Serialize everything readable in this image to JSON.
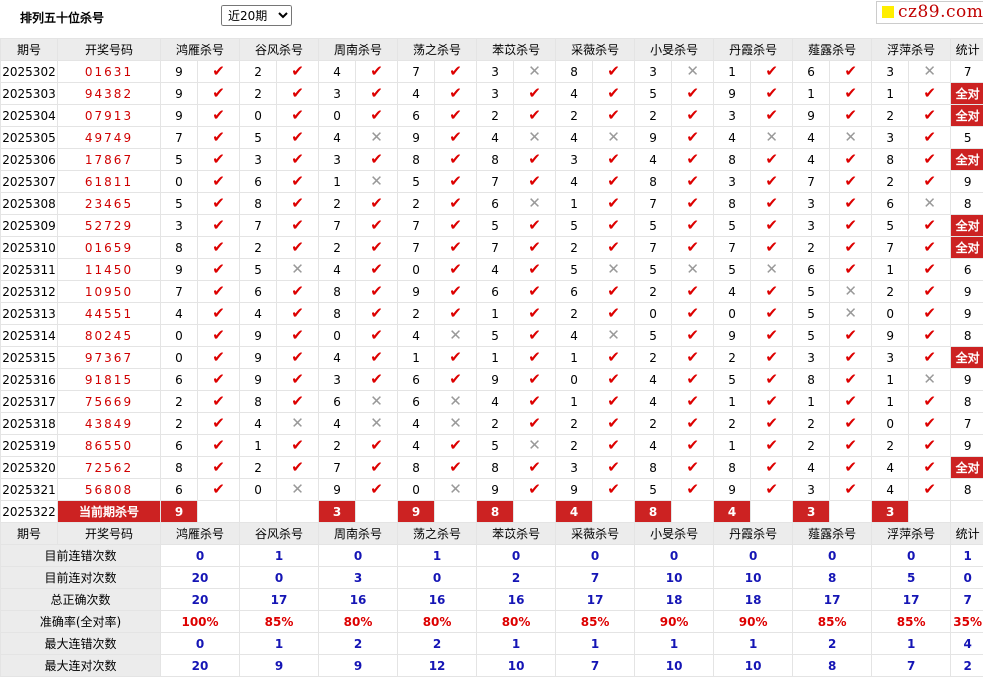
{
  "header": {
    "title": "排列五十位杀号",
    "period_select": "近20期",
    "logo_text": "cz89.com"
  },
  "columns": {
    "issue": "期号",
    "draw": "开奖号码",
    "stat": "统计",
    "killers": [
      "鸿雁杀号",
      "谷风杀号",
      "周南杀号",
      "荡之杀号",
      "苯苡杀号",
      "采薇杀号",
      "小旻杀号",
      "丹霞杀号",
      "薤露杀号",
      "浮萍杀号"
    ]
  },
  "rows": [
    {
      "issue": "2025302",
      "draw": "01631",
      "kills": [
        [
          9,
          1
        ],
        [
          2,
          1
        ],
        [
          4,
          1
        ],
        [
          7,
          1
        ],
        [
          3,
          0
        ],
        [
          8,
          1
        ],
        [
          3,
          0
        ],
        [
          1,
          1
        ],
        [
          6,
          1
        ],
        [
          3,
          0
        ]
      ],
      "stat": "7"
    },
    {
      "issue": "2025303",
      "draw": "94382",
      "kills": [
        [
          9,
          1
        ],
        [
          2,
          1
        ],
        [
          3,
          1
        ],
        [
          4,
          1
        ],
        [
          3,
          1
        ],
        [
          4,
          1
        ],
        [
          5,
          1
        ],
        [
          9,
          1
        ],
        [
          1,
          1
        ],
        [
          1,
          1
        ]
      ],
      "stat": "全对"
    },
    {
      "issue": "2025304",
      "draw": "07913",
      "kills": [
        [
          9,
          1
        ],
        [
          0,
          1
        ],
        [
          0,
          1
        ],
        [
          6,
          1
        ],
        [
          2,
          1
        ],
        [
          2,
          1
        ],
        [
          2,
          1
        ],
        [
          3,
          1
        ],
        [
          9,
          1
        ],
        [
          2,
          1
        ]
      ],
      "stat": "全对"
    },
    {
      "issue": "2025305",
      "draw": "49749",
      "kills": [
        [
          7,
          1
        ],
        [
          5,
          1
        ],
        [
          4,
          0
        ],
        [
          9,
          1
        ],
        [
          4,
          0
        ],
        [
          4,
          0
        ],
        [
          9,
          1
        ],
        [
          4,
          0
        ],
        [
          4,
          0
        ],
        [
          3,
          1
        ]
      ],
      "stat": "5"
    },
    {
      "issue": "2025306",
      "draw": "17867",
      "kills": [
        [
          5,
          1
        ],
        [
          3,
          1
        ],
        [
          3,
          1
        ],
        [
          8,
          1
        ],
        [
          8,
          1
        ],
        [
          3,
          1
        ],
        [
          4,
          1
        ],
        [
          8,
          1
        ],
        [
          4,
          1
        ],
        [
          8,
          1
        ]
      ],
      "stat": "全对"
    },
    {
      "issue": "2025307",
      "draw": "61811",
      "kills": [
        [
          0,
          1
        ],
        [
          6,
          1
        ],
        [
          1,
          0
        ],
        [
          5,
          1
        ],
        [
          7,
          1
        ],
        [
          4,
          1
        ],
        [
          8,
          1
        ],
        [
          3,
          1
        ],
        [
          7,
          1
        ],
        [
          2,
          1
        ]
      ],
      "stat": "9"
    },
    {
      "issue": "2025308",
      "draw": "23465",
      "kills": [
        [
          5,
          1
        ],
        [
          8,
          1
        ],
        [
          2,
          1
        ],
        [
          2,
          1
        ],
        [
          6,
          0
        ],
        [
          1,
          1
        ],
        [
          7,
          1
        ],
        [
          8,
          1
        ],
        [
          3,
          1
        ],
        [
          6,
          0
        ]
      ],
      "stat": "8"
    },
    {
      "issue": "2025309",
      "draw": "52729",
      "kills": [
        [
          3,
          1
        ],
        [
          7,
          1
        ],
        [
          7,
          1
        ],
        [
          7,
          1
        ],
        [
          5,
          1
        ],
        [
          5,
          1
        ],
        [
          5,
          1
        ],
        [
          5,
          1
        ],
        [
          3,
          1
        ],
        [
          5,
          1
        ]
      ],
      "stat": "全对"
    },
    {
      "issue": "2025310",
      "draw": "01659",
      "kills": [
        [
          8,
          1
        ],
        [
          2,
          1
        ],
        [
          2,
          1
        ],
        [
          7,
          1
        ],
        [
          7,
          1
        ],
        [
          2,
          1
        ],
        [
          7,
          1
        ],
        [
          7,
          1
        ],
        [
          2,
          1
        ],
        [
          7,
          1
        ]
      ],
      "stat": "全对"
    },
    {
      "issue": "2025311",
      "draw": "11450",
      "kills": [
        [
          9,
          1
        ],
        [
          5,
          0
        ],
        [
          4,
          1
        ],
        [
          0,
          1
        ],
        [
          4,
          1
        ],
        [
          5,
          0
        ],
        [
          5,
          0
        ],
        [
          5,
          0
        ],
        [
          6,
          1
        ],
        [
          1,
          1
        ]
      ],
      "stat": "6"
    },
    {
      "issue": "2025312",
      "draw": "10950",
      "kills": [
        [
          7,
          1
        ],
        [
          6,
          1
        ],
        [
          8,
          1
        ],
        [
          9,
          1
        ],
        [
          6,
          1
        ],
        [
          6,
          1
        ],
        [
          2,
          1
        ],
        [
          4,
          1
        ],
        [
          5,
          0
        ],
        [
          2,
          1
        ]
      ],
      "stat": "9"
    },
    {
      "issue": "2025313",
      "draw": "44551",
      "kills": [
        [
          4,
          1
        ],
        [
          4,
          1
        ],
        [
          8,
          1
        ],
        [
          2,
          1
        ],
        [
          1,
          1
        ],
        [
          2,
          1
        ],
        [
          0,
          1
        ],
        [
          0,
          1
        ],
        [
          5,
          0
        ],
        [
          0,
          1
        ]
      ],
      "stat": "9"
    },
    {
      "issue": "2025314",
      "draw": "80245",
      "kills": [
        [
          0,
          1
        ],
        [
          9,
          1
        ],
        [
          0,
          1
        ],
        [
          4,
          0
        ],
        [
          5,
          1
        ],
        [
          4,
          0
        ],
        [
          5,
          1
        ],
        [
          9,
          1
        ],
        [
          5,
          1
        ],
        [
          9,
          1
        ]
      ],
      "stat": "8"
    },
    {
      "issue": "2025315",
      "draw": "97367",
      "kills": [
        [
          0,
          1
        ],
        [
          9,
          1
        ],
        [
          4,
          1
        ],
        [
          1,
          1
        ],
        [
          1,
          1
        ],
        [
          1,
          1
        ],
        [
          2,
          1
        ],
        [
          2,
          1
        ],
        [
          3,
          1
        ],
        [
          3,
          1
        ]
      ],
      "stat": "全对"
    },
    {
      "issue": "2025316",
      "draw": "91815",
      "kills": [
        [
          6,
          1
        ],
        [
          9,
          1
        ],
        [
          3,
          1
        ],
        [
          6,
          1
        ],
        [
          9,
          1
        ],
        [
          0,
          1
        ],
        [
          4,
          1
        ],
        [
          5,
          1
        ],
        [
          8,
          1
        ],
        [
          1,
          0
        ]
      ],
      "stat": "9"
    },
    {
      "issue": "2025317",
      "draw": "75669",
      "kills": [
        [
          2,
          1
        ],
        [
          8,
          1
        ],
        [
          6,
          0
        ],
        [
          6,
          0
        ],
        [
          4,
          1
        ],
        [
          1,
          1
        ],
        [
          4,
          1
        ],
        [
          1,
          1
        ],
        [
          1,
          1
        ],
        [
          1,
          1
        ]
      ],
      "stat": "8"
    },
    {
      "issue": "2025318",
      "draw": "43849",
      "kills": [
        [
          2,
          1
        ],
        [
          4,
          0
        ],
        [
          4,
          0
        ],
        [
          4,
          0
        ],
        [
          2,
          1
        ],
        [
          2,
          1
        ],
        [
          2,
          1
        ],
        [
          2,
          1
        ],
        [
          2,
          1
        ],
        [
          0,
          1
        ]
      ],
      "stat": "7"
    },
    {
      "issue": "2025319",
      "draw": "86550",
      "kills": [
        [
          6,
          1
        ],
        [
          1,
          1
        ],
        [
          2,
          1
        ],
        [
          4,
          1
        ],
        [
          5,
          0
        ],
        [
          2,
          1
        ],
        [
          4,
          1
        ],
        [
          1,
          1
        ],
        [
          2,
          1
        ],
        [
          2,
          1
        ]
      ],
      "stat": "9"
    },
    {
      "issue": "2025320",
      "draw": "72562",
      "kills": [
        [
          8,
          1
        ],
        [
          2,
          1
        ],
        [
          7,
          1
        ],
        [
          8,
          1
        ],
        [
          8,
          1
        ],
        [
          3,
          1
        ],
        [
          8,
          1
        ],
        [
          8,
          1
        ],
        [
          4,
          1
        ],
        [
          4,
          1
        ]
      ],
      "stat": "全对"
    },
    {
      "issue": "2025321",
      "draw": "56808",
      "kills": [
        [
          6,
          1
        ],
        [
          0,
          0
        ],
        [
          9,
          1
        ],
        [
          0,
          0
        ],
        [
          9,
          1
        ],
        [
          9,
          1
        ],
        [
          5,
          1
        ],
        [
          9,
          1
        ],
        [
          3,
          1
        ],
        [
          4,
          1
        ]
      ],
      "stat": "8"
    }
  ],
  "current": {
    "issue": "2025322",
    "label": "当前期杀号",
    "kills": [
      9,
      "",
      3,
      9,
      8,
      4,
      8,
      4,
      3,
      3
    ]
  },
  "stats": [
    {
      "label": "目前连错次数",
      "values": [
        "0",
        "1",
        "0",
        "1",
        "0",
        "0",
        "0",
        "0",
        "0",
        "0"
      ],
      "stat": "1"
    },
    {
      "label": "目前连对次数",
      "values": [
        "20",
        "0",
        "3",
        "0",
        "2",
        "7",
        "10",
        "10",
        "8",
        "5"
      ],
      "stat": "0"
    },
    {
      "label": "总正确次数",
      "values": [
        "20",
        "17",
        "16",
        "16",
        "16",
        "17",
        "18",
        "18",
        "17",
        "17"
      ],
      "stat": "7"
    },
    {
      "label": "准确率(全对率)",
      "values": [
        "100%",
        "85%",
        "80%",
        "80%",
        "80%",
        "85%",
        "90%",
        "90%",
        "85%",
        "85%"
      ],
      "stat": "35%"
    },
    {
      "label": "最大连错次数",
      "values": [
        "0",
        "1",
        "2",
        "2",
        "1",
        "1",
        "1",
        "1",
        "2",
        "1"
      ],
      "stat": "4"
    },
    {
      "label": "最大连对次数",
      "values": [
        "20",
        "9",
        "9",
        "12",
        "10",
        "7",
        "10",
        "10",
        "8",
        "7"
      ],
      "stat": "2"
    }
  ],
  "icons": {
    "hit": "check-icon",
    "miss": "cross-icon"
  },
  "colors": {
    "accent": "#cc2222",
    "check": "#dd0000",
    "cross": "#999999",
    "stat_blue": "#1515b5",
    "header_gray": "#ececec"
  }
}
